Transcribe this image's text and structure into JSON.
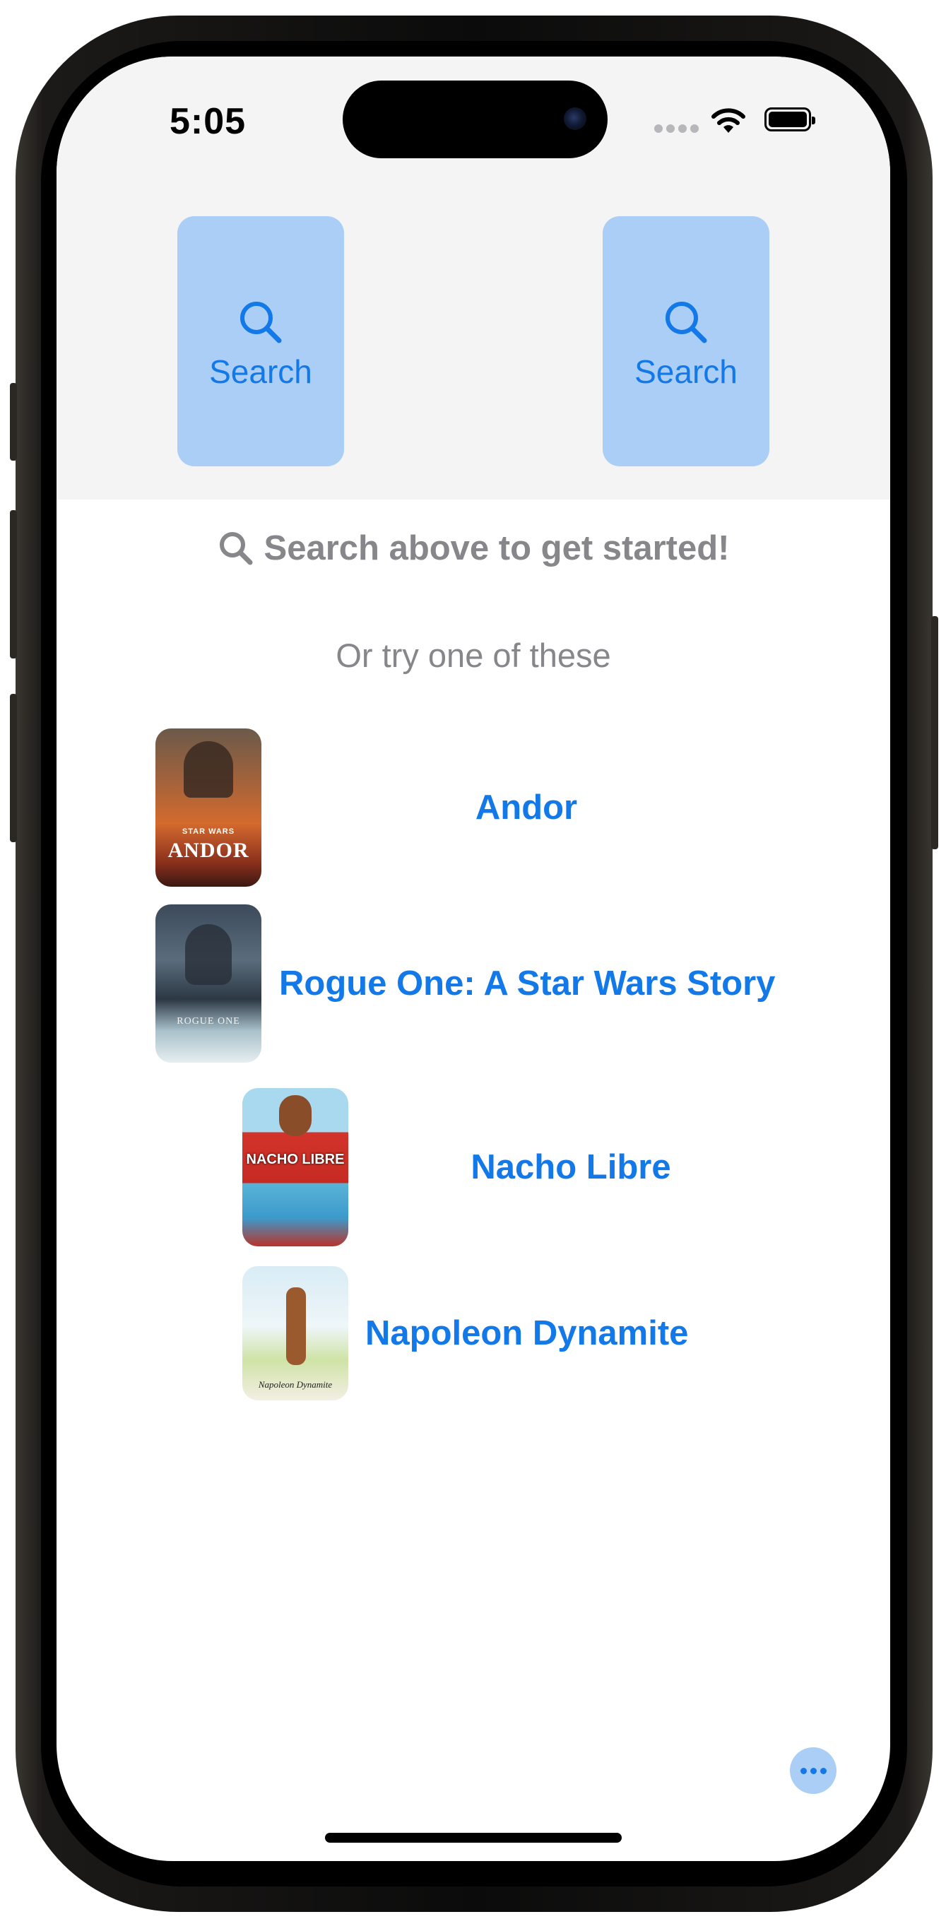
{
  "status_bar": {
    "time": "5:05"
  },
  "search_buttons": [
    {
      "label": "Search",
      "icon": "magnifier-icon"
    },
    {
      "label": "Search",
      "icon": "magnifier-icon"
    }
  ],
  "prompt": {
    "icon": "magnifier-icon",
    "text": "Search above to get started!"
  },
  "suggestions_heading": "Or try one of these",
  "suggestions": [
    {
      "title": "Andor",
      "poster_text": "ANDOR",
      "poster_kicker": "STAR WARS"
    },
    {
      "title": "Rogue One: A Star Wars Story",
      "poster_text": "ROGUE ONE"
    },
    {
      "title": "Nacho Libre",
      "poster_text": "NACHO LIBRE"
    },
    {
      "title": "Napoleon Dynamite",
      "poster_text": "Napoleon Dynamite"
    }
  ],
  "colors": {
    "accent": "#1378e8",
    "button_bg": "#aacef5",
    "secondary_text": "#86868b",
    "header_bg": "#f4f4f5"
  },
  "more_button": {
    "icon": "ellipsis-icon"
  }
}
